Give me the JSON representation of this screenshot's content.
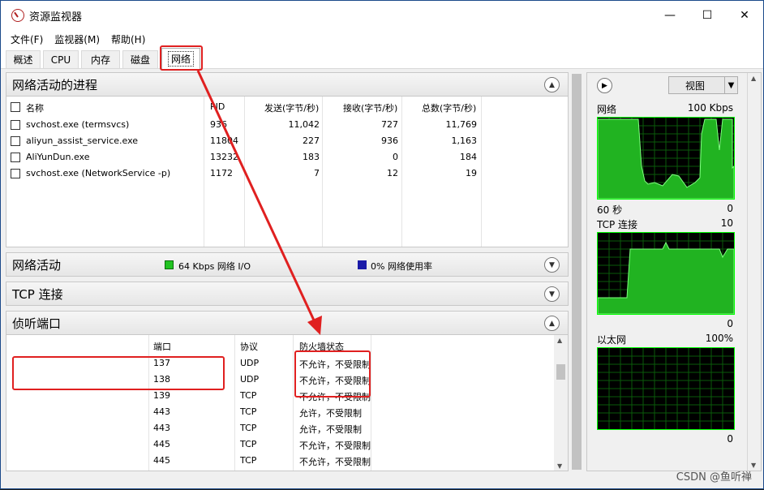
{
  "window": {
    "title": "资源监视器",
    "controls": {
      "minimize": "—",
      "maximize": "☐",
      "close": "✕"
    }
  },
  "menu": [
    "文件(F)",
    "监视器(M)",
    "帮助(H)"
  ],
  "tabs": [
    "概述",
    "CPU",
    "内存",
    "磁盘",
    "网络"
  ],
  "active_tab": "网络",
  "processes": {
    "title": "网络活动的进程",
    "columns": [
      "名称",
      "PID",
      "发送(字节/秒)",
      "接收(字节/秒)",
      "总数(字节/秒)"
    ],
    "rows": [
      [
        "svchost.exe (termsvcs)",
        "936",
        "11,042",
        "727",
        "11,769"
      ],
      [
        "aliyun_assist_service.exe",
        "11804",
        "227",
        "936",
        "1,163"
      ],
      [
        "AliYunDun.exe",
        "13232",
        "183",
        "0",
        "184"
      ],
      [
        "svchost.exe (NetworkService -p)",
        "1172",
        "7",
        "12",
        "19"
      ]
    ]
  },
  "network_activity": {
    "title": "网络活动",
    "io_label": "64 Kbps 网络 I/O",
    "usage_label": "0% 网络使用率",
    "io_color": "#21c321",
    "usage_color": "#1a1aa8"
  },
  "tcp": {
    "title": "TCP 连接"
  },
  "listening": {
    "title": "侦听端口",
    "columns": [
      "端口",
      "协议",
      "防火墙状态"
    ],
    "rows": [
      [
        "137",
        "UDP",
        "不允许，不受限制"
      ],
      [
        "138",
        "UDP",
        "不允许，不受限制"
      ],
      [
        "139",
        "TCP",
        "不允许，不受限制"
      ],
      [
        "443",
        "TCP",
        "允许，不受限制"
      ],
      [
        "443",
        "TCP",
        "允许，不受限制"
      ],
      [
        "445",
        "TCP",
        "不允许，不受限制"
      ],
      [
        "445",
        "TCP",
        "不允许，不受限制"
      ]
    ]
  },
  "right_panel": {
    "view_label": "视图",
    "graphs": [
      {
        "title": "网络",
        "max": "100 Kbps",
        "time": "60 秒",
        "min": "0"
      },
      {
        "title": "TCP 连接",
        "max": "10",
        "time": "",
        "min": "0"
      },
      {
        "title": "以太网",
        "max": "100%",
        "time": "",
        "min": "0"
      }
    ]
  },
  "watermark": "CSDN @鱼听禅"
}
